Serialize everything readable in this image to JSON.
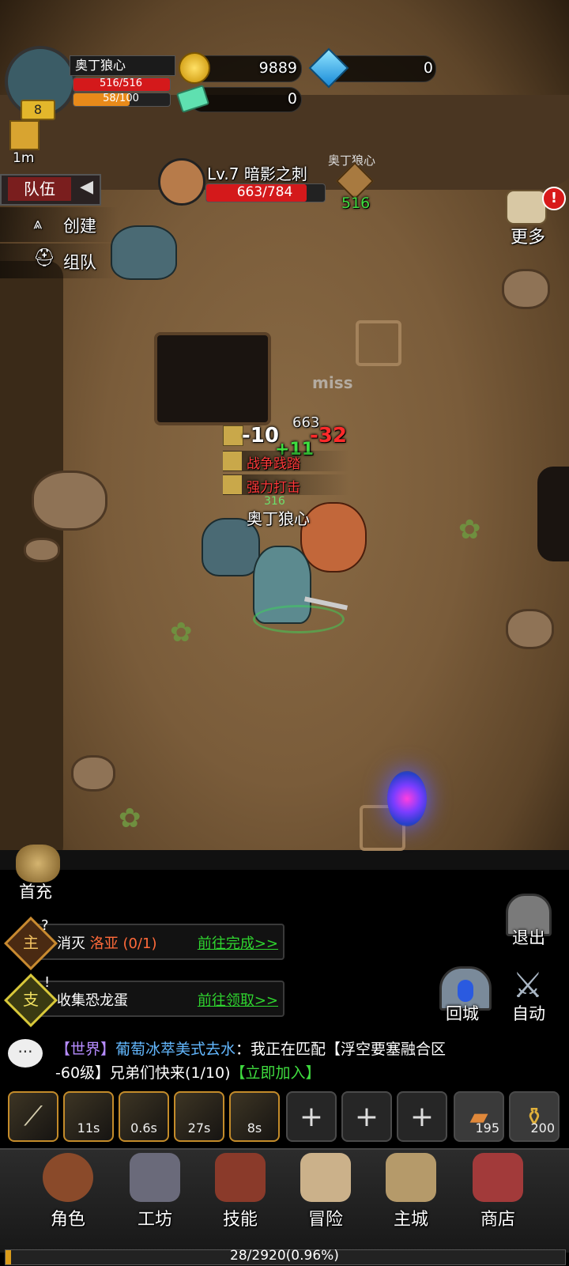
{
  "player": {
    "name": "奥丁狼心",
    "level": "8",
    "hp": "516/516",
    "hp_fraction": 1.0,
    "exp": "58/100",
    "exp_fraction": 0.58,
    "buff_timer": "1m"
  },
  "currency": {
    "gold": "9889",
    "diamond": "0",
    "ticket": "0"
  },
  "team_panel": {
    "title": "队伍",
    "create": "创建",
    "team": "组队"
  },
  "target": {
    "name": "Lv.7 暗影之刺",
    "hp": "663/784",
    "hp_fraction": 0.846
  },
  "ally_marker": {
    "name": "奥丁狼心",
    "value": "516"
  },
  "more_label": "更多",
  "battle_text": {
    "miss": "miss",
    "dmg1": "-10",
    "dmg2": "-32",
    "heal": "+11",
    "skill1": "战争践踏",
    "skill2": "强力打击",
    "hero_label": "奥丁狼心",
    "enemy_hp_top": "663",
    "small_num": "316"
  },
  "first_charge": "首充",
  "exit_label": "退出",
  "return_city": "回城",
  "auto_label": "自动",
  "quests": [
    {
      "badge": "主",
      "text": "消灭 ",
      "target": "洛亚",
      "progress": " (0/1)",
      "action": "前往完成>>"
    },
    {
      "badge": "支",
      "text": "收集恐龙蛋",
      "target": "",
      "progress": "",
      "action": "前往领取>>"
    }
  ],
  "chat": {
    "channel": "【世界】",
    "sender": "葡萄冰萃美式去水",
    "message_a": "：我正在匹配【浮空要塞融合区",
    "message_b": "-60级】兄弟们快来(1/10)",
    "join": "【立即加入】"
  },
  "skills": {
    "cd1": "11s",
    "cd2": "0.6s",
    "cd3": "27s",
    "cd4": "8s",
    "item1_count": "195",
    "item2_count": "200"
  },
  "nav": [
    "角色",
    "工坊",
    "技能",
    "冒险",
    "主城",
    "商店"
  ],
  "exp_bar": {
    "text": "28/2920(0.96%)",
    "fraction": 0.0096
  },
  "colors": {
    "hp_red": "#d4191b",
    "exp_orange": "#e88a1a",
    "quest_green": "#2fd42f",
    "chat_purple": "#b68cff",
    "chat_blue": "#63b8ff",
    "chat_green": "#3fdc3f",
    "dmg_red": "#ff2a2a"
  }
}
